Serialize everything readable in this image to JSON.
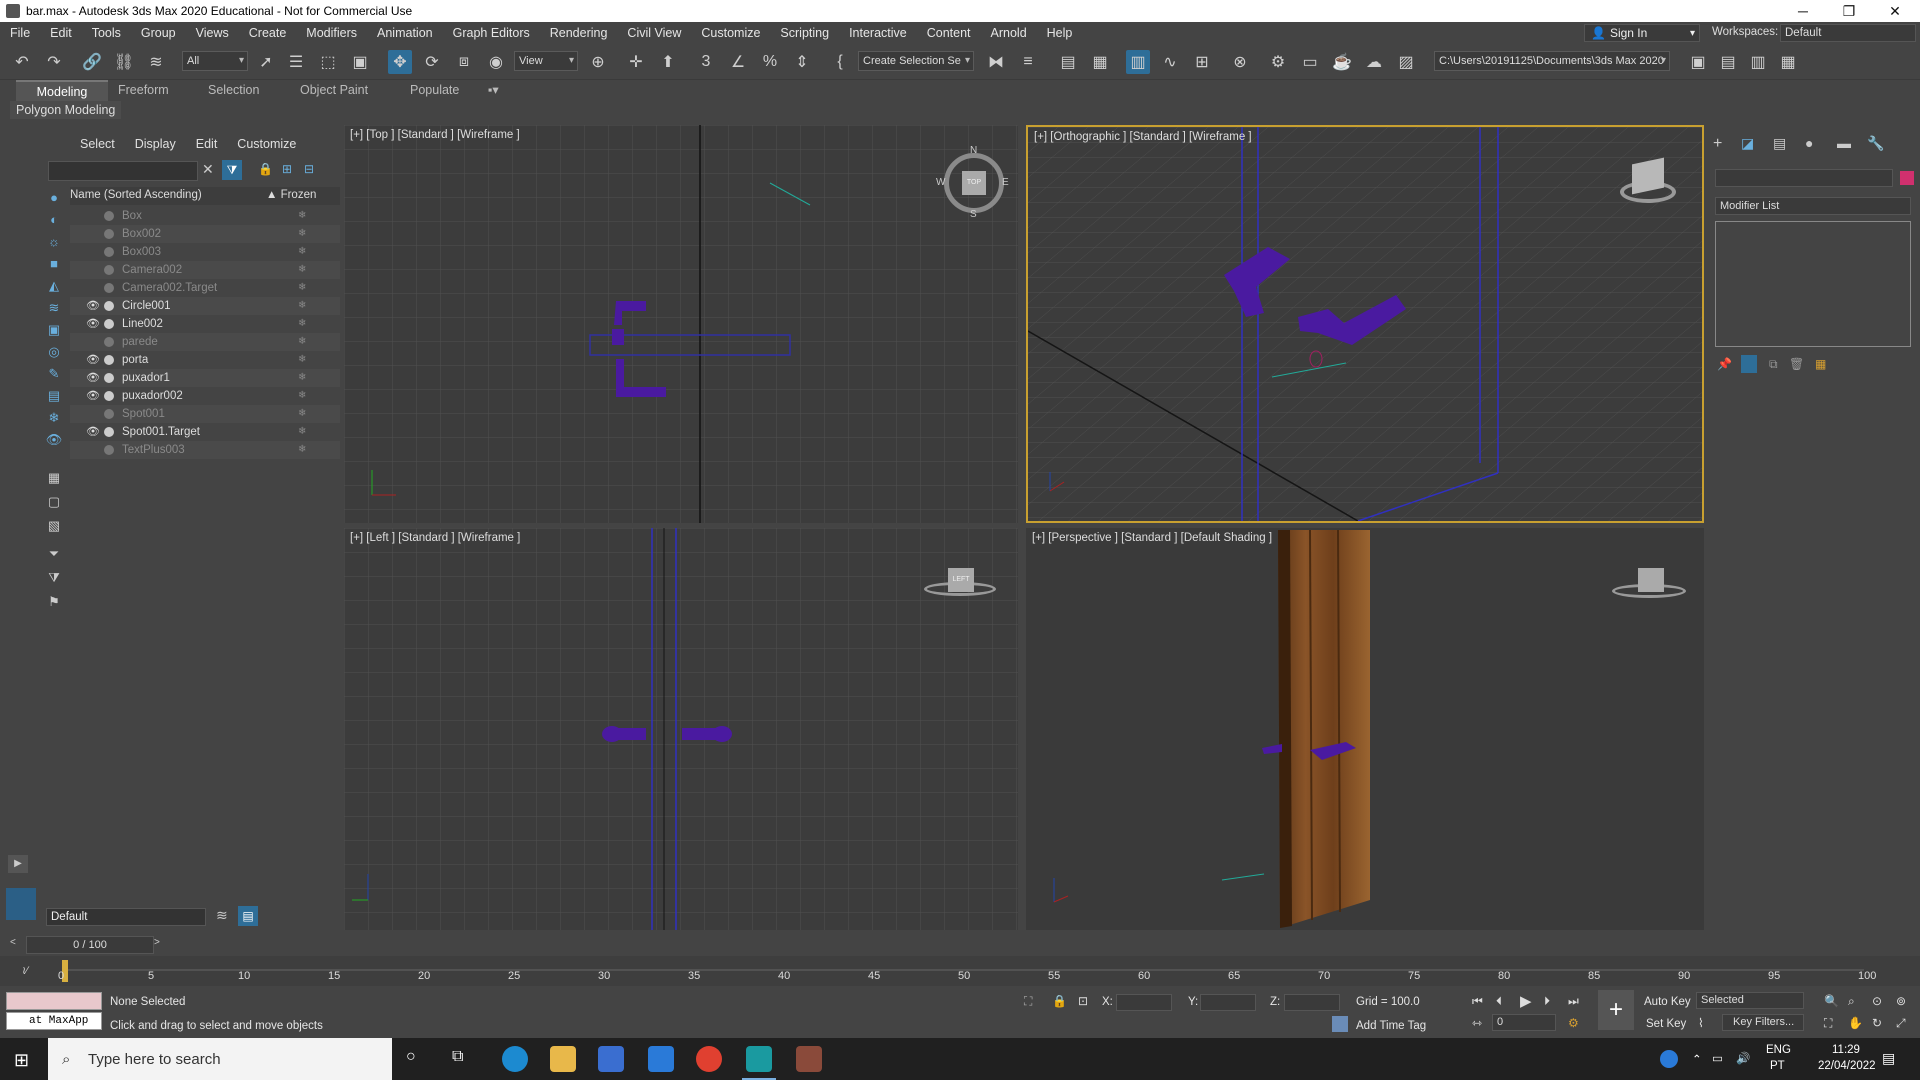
{
  "window": {
    "title": "bar.max - Autodesk 3ds Max 2020 Educational - Not for Commercial Use"
  },
  "menu": [
    "File",
    "Edit",
    "Tools",
    "Group",
    "Views",
    "Create",
    "Modifiers",
    "Animation",
    "Graph Editors",
    "Rendering",
    "Civil View",
    "Customize",
    "Scripting",
    "Interactive",
    "Content",
    "Arnold",
    "Help"
  ],
  "account": {
    "signin": "Sign In",
    "workspaces_label": "Workspaces:",
    "workspace": "Default"
  },
  "toolbar": {
    "selection_filter": "All",
    "ref_coord": "View",
    "selection_set": "Create Selection Se",
    "project_path": "C:\\Users\\20191125\\Documents\\3ds Max 2020"
  },
  "ribbon": {
    "tabs": [
      "Modeling",
      "Freeform",
      "Selection",
      "Object Paint",
      "Populate"
    ],
    "active": "Modeling",
    "panel_label": "Polygon Modeling"
  },
  "explorer": {
    "tabs": [
      "Select",
      "Display",
      "Edit",
      "Customize"
    ],
    "col_name": "Name (Sorted Ascending)",
    "col_frozen": "▲ Frozen",
    "items": [
      {
        "name": "Box",
        "visible": false
      },
      {
        "name": "Box002",
        "visible": false
      },
      {
        "name": "Box003",
        "visible": false
      },
      {
        "name": "Camera002",
        "visible": false
      },
      {
        "name": "Camera002.Target",
        "visible": false
      },
      {
        "name": "Circle001",
        "visible": true
      },
      {
        "name": "Line002",
        "visible": true
      },
      {
        "name": "parede",
        "visible": false
      },
      {
        "name": "porta",
        "visible": true
      },
      {
        "name": "puxador1",
        "visible": true
      },
      {
        "name": "puxador002",
        "visible": true
      },
      {
        "name": "Spot001",
        "visible": false
      },
      {
        "name": "Spot001.Target",
        "visible": true
      },
      {
        "name": "TextPlus003",
        "visible": false
      }
    ],
    "layer": "Default"
  },
  "viewports": {
    "top": "[+] [Top ] [Standard ] [Wireframe ]",
    "ortho": "[+] [Orthographic ] [Standard ] [Wireframe ]",
    "left": "[+] [Left ] [Standard ] [Wireframe ]",
    "persp": "[+] [Perspective ] [Standard ] [Default Shading ]",
    "compass": {
      "n": "N",
      "s": "S",
      "e": "E",
      "w": "W"
    },
    "cube_top": "TOP",
    "cube_left": "LEFT"
  },
  "command_panel": {
    "modifier_list": "Modifier List"
  },
  "timeline": {
    "frame": "0 / 100",
    "ticks": [
      "0",
      "5",
      "10",
      "15",
      "20",
      "25",
      "30",
      "35",
      "40",
      "45",
      "50",
      "55",
      "60",
      "65",
      "70",
      "75",
      "80",
      "85",
      "90",
      "95",
      "100"
    ]
  },
  "status": {
    "maxscript": "at MaxApp",
    "selection": "None Selected",
    "prompt": "Click and drag to select and move objects",
    "x_label": "X:",
    "y_label": "Y:",
    "z_label": "Z:",
    "grid": "Grid = 100.0",
    "add_time_tag": "Add Time Tag",
    "auto_key": "Auto Key",
    "set_key": "Set Key",
    "key_mode": "Selected",
    "key_filters": "Key Filters...",
    "frame_field": "0"
  },
  "taskbar": {
    "search": "Type here to search",
    "lang1": "ENG",
    "lang2": "PT",
    "time": "11:29",
    "date": "22/04/2022"
  }
}
